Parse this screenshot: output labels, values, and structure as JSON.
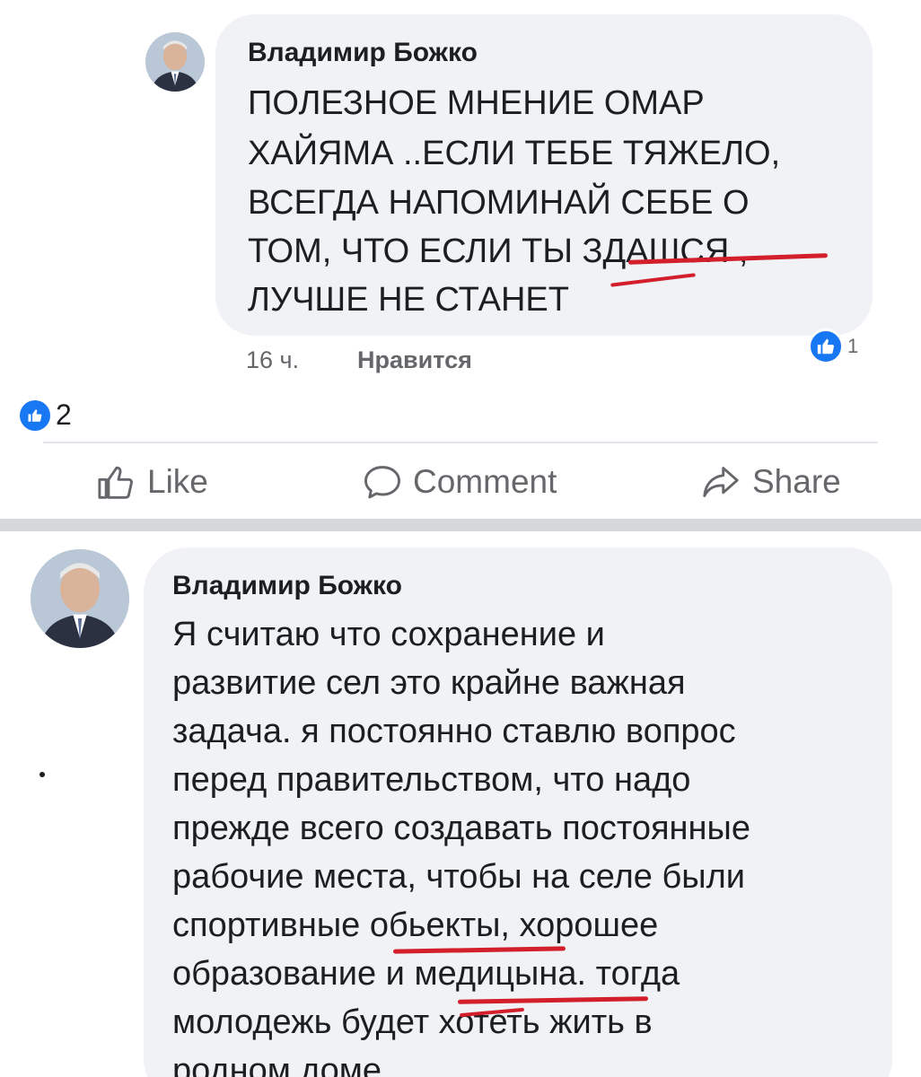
{
  "comment1": {
    "author": "Владимир Божко",
    "lines": [
      "ПОЛЕЗНОЕ МНЕНИЕ ОМАР",
      "ХАЙЯМА ..ЕСЛИ ТЕБЕ ТЯЖЕЛО,",
      "ВСЕГДА НАПОМИНАЙ СЕБЕ О",
      "ТОМ, ЧТО ЕСЛИ ТЫ ЗДАШСЯ ,",
      "ЛУЧШЕ НЕ СТАНЕТ"
    ],
    "time": "16 ч.",
    "like_label": "Нравится",
    "reaction_count": "1"
  },
  "post": {
    "reaction_count": "2",
    "actions": {
      "like": "Like",
      "comment": "Comment",
      "share": "Share"
    }
  },
  "comment2": {
    "author": "Владимир Божко",
    "lines": [
      "Я считаю что сохранение и",
      "развитие сел это крайне важная",
      "задача. я постоянно  ставлю вопрос",
      "перед правительством, что надо",
      "прежде всего создавать постоянные",
      "рабочие места, чтобы на селе были",
      "спортивные обьекты, хорошее",
      "образование и медицына. тогда",
      "молодежь будет хотеть жить в",
      "родном доме"
    ]
  },
  "colors": {
    "accent": "#1877f2",
    "annotation": "#d21f2b",
    "bubble": "#f0f2f5",
    "secondary_text": "#65676b"
  }
}
